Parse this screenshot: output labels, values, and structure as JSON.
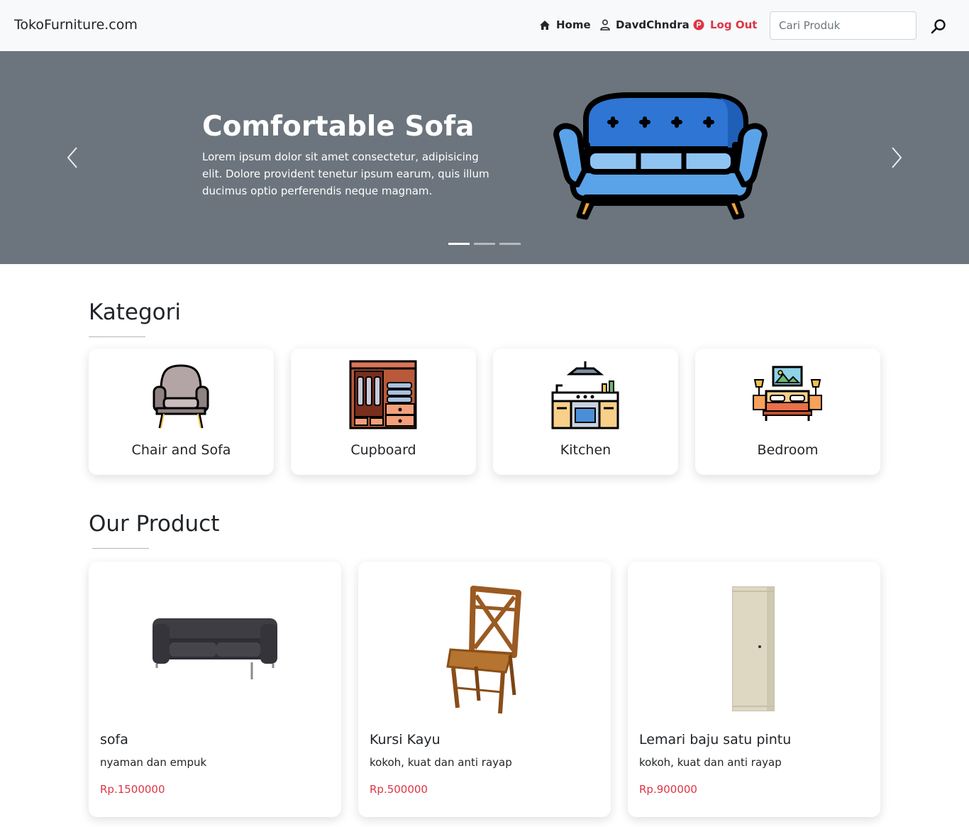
{
  "navbar": {
    "brand": "TokoFurniture.com",
    "home_label": "Home",
    "user_label": "DavdChndra",
    "logout_label": "Log Out",
    "search_placeholder": "Cari Produk"
  },
  "carousel": {
    "title": "Comfortable Sofa",
    "text": "Lorem ipsum dolor sit amet consectetur, adipisicing elit. Dolore provident tenetur ipsum earum, quis illum ducimus optio perferendis neque magnam.",
    "slide_count": 3,
    "active_slide": 1
  },
  "kategori": {
    "title": "Kategori",
    "items": [
      {
        "label": "Chair and Sofa",
        "icon": "armchair-icon"
      },
      {
        "label": "Cupboard",
        "icon": "cupboard-icon"
      },
      {
        "label": "Kitchen",
        "icon": "kitchen-icon"
      },
      {
        "label": "Bedroom",
        "icon": "bedroom-icon"
      }
    ]
  },
  "products": {
    "title": "Our Product",
    "items": [
      {
        "name": "sofa",
        "desc": "nyaman dan empuk",
        "price": "Rp.1500000"
      },
      {
        "name": "Kursi Kayu",
        "desc": "kokoh, kuat dan anti rayap",
        "price": "Rp.500000"
      },
      {
        "name": "Lemari baju satu pintu",
        "desc": "kokoh, kuat dan anti rayap",
        "price": "Rp.900000"
      }
    ]
  },
  "colors": {
    "navbar_bg": "#f8f9fa",
    "carousel_bg": "#6c757d",
    "price": "#dc3545",
    "logout": "#dc3545"
  }
}
